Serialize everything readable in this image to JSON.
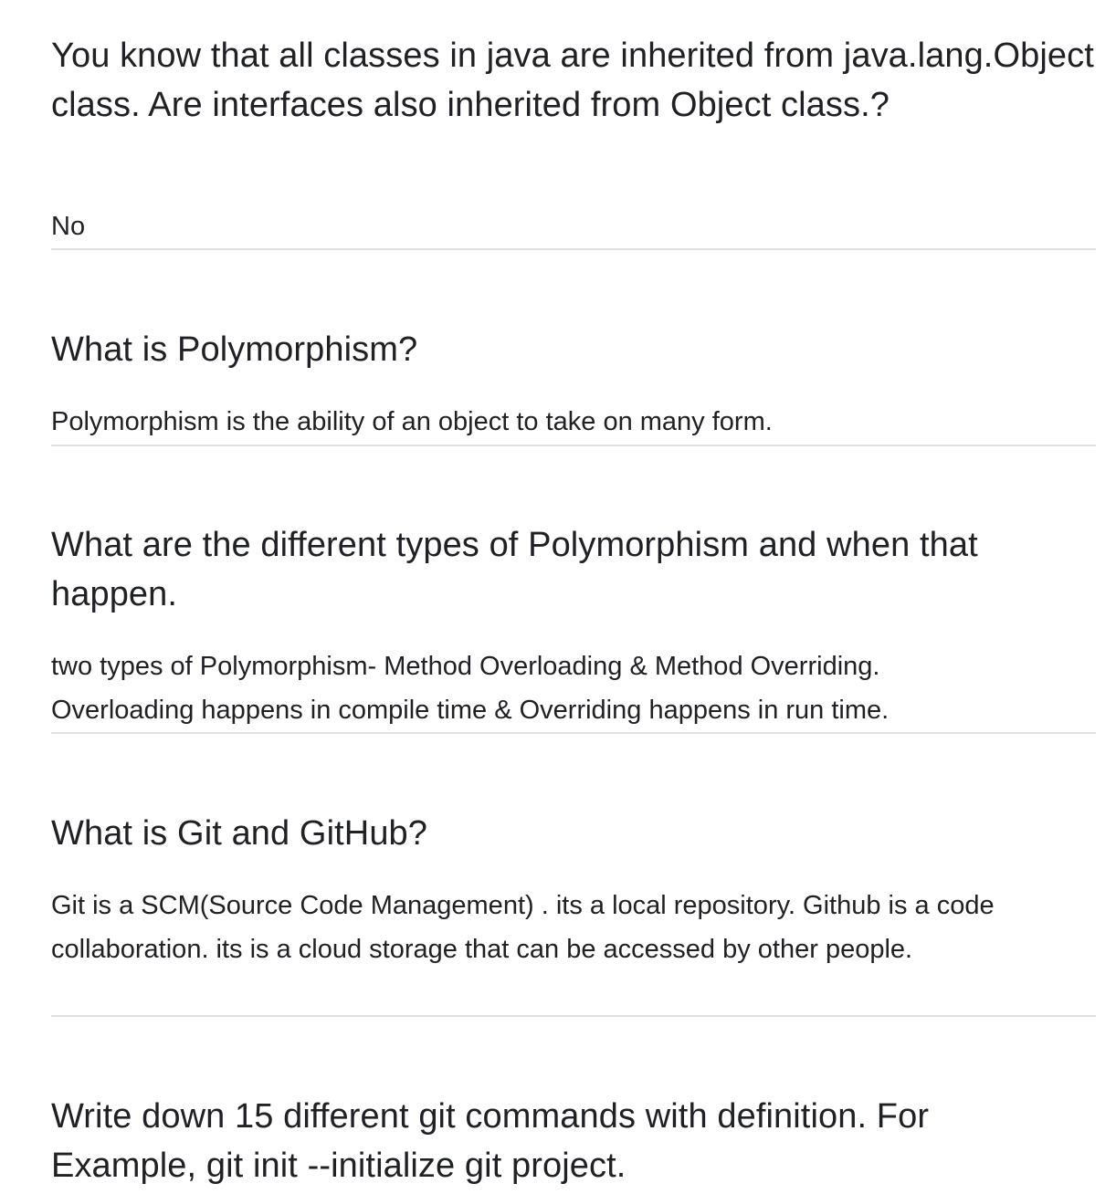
{
  "items": [
    {
      "question": "You know that all classes in java are inherited from java.lang.Object class. Are interfaces also inherited from Object class.?",
      "answer": "No"
    },
    {
      "question": "What is Polymorphism?",
      "answer": "Polymorphism is the ability of an object to take on many form."
    },
    {
      "question": "What are the different types of Polymorphism and when that happen.",
      "answer": "two types of Polymorphism- Method Overloading & Method Overriding. Overloading happens in compile time & Overriding happens in run time."
    },
    {
      "question": "What is Git and GitHub?",
      "answer": "Git is a SCM(Source Code Management) . its a local repository. Github is a code collaboration. its is a cloud storage that can be accessed by other people."
    },
    {
      "question": "Write down 15 different git commands with definition. For Example, git init --initialize git project."
    }
  ]
}
